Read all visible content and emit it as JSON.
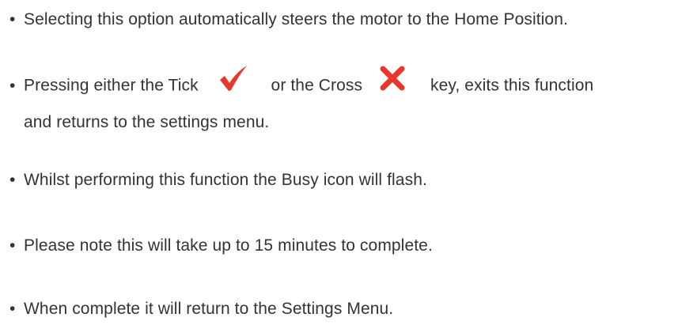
{
  "bullet": "•",
  "items": [
    {
      "text": "Selecting this option automatically steers the motor to the Home Position."
    },
    {
      "part1": "Pressing either the Tick",
      "tick_icon": "tick-icon",
      "part2": "or the Cross",
      "cross_icon": "cross-icon",
      "part3": "key, exits this function",
      "line2": "and returns to the settings menu."
    },
    {
      "text": "Whilst performing this function the Busy icon will flash."
    },
    {
      "text": "Please note this will take up to 15 minutes to complete."
    },
    {
      "text": "When complete it will return to the Settings Menu."
    }
  ],
  "colors": {
    "text": "#333333",
    "icon_red": "#e8372c"
  }
}
